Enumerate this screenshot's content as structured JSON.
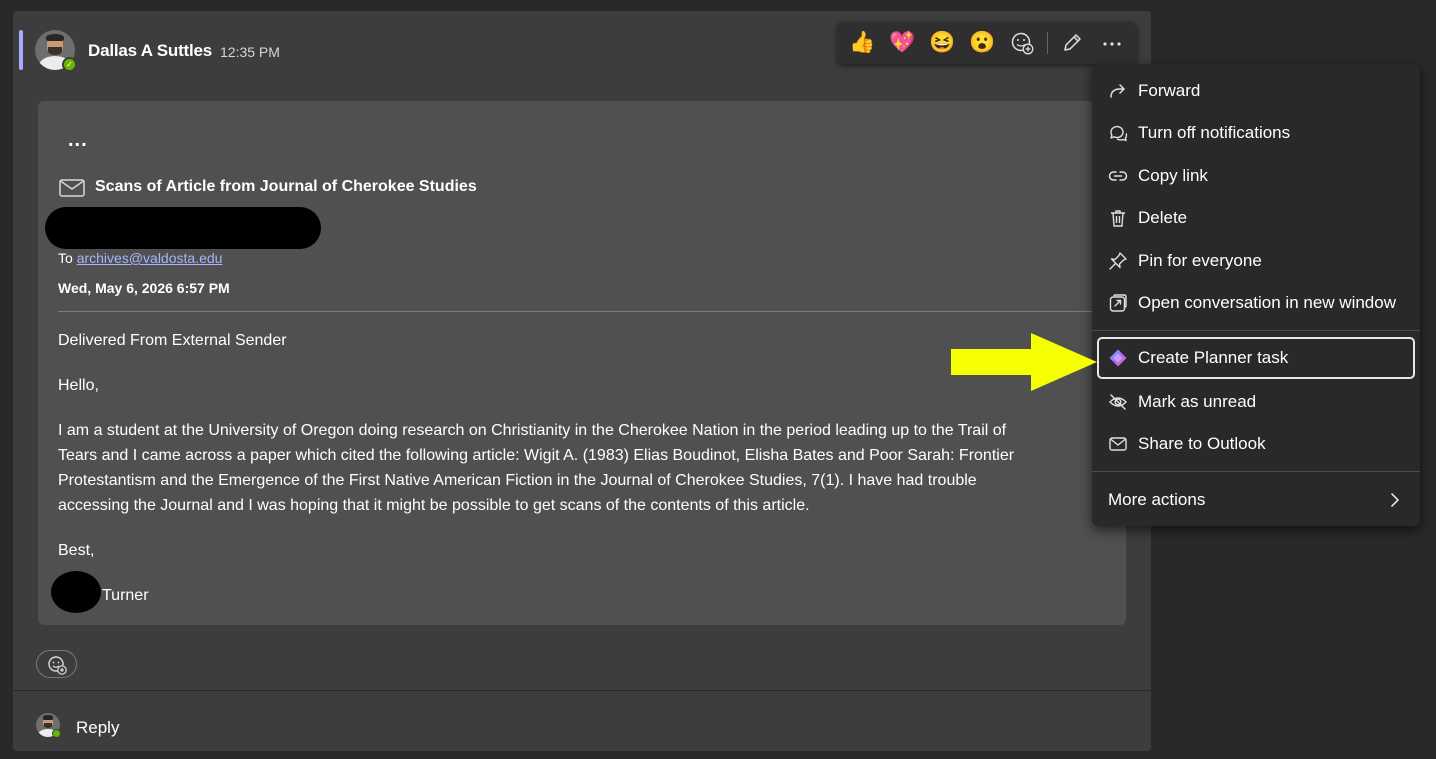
{
  "message": {
    "sender": "Dallas A Suttles",
    "time": "12:35 PM"
  },
  "reactions": [
    "thumbs-up-icon",
    "heart-icon",
    "laugh-icon",
    "surprised-icon",
    "add-reaction-icon"
  ],
  "email": {
    "more_label": "...",
    "subject": "Scans of Article from Journal of Cherokee Studies",
    "to_label": "To",
    "to_address": "archives@valdosta.edu",
    "date": "Wed, May 6, 2026 6:57 PM",
    "external_notice": "Delivered From External Sender",
    "greeting": "Hello,",
    "body_lines": [
      "I am a student at the University of Oregon doing research on Christianity in the Cherokee Nation in the period leading up to the Trail of",
      "Tears and I came across a paper which cited the following article: Wigit A. (1983) Elias Boudinot, Elisha Bates and Poor Sarah: Frontier",
      "Protestantism and the Emergence of the First Native American Fiction in the Journal of Cherokee Studies, 7(1). I have had trouble",
      "accessing the Journal and I was hoping that it might be possible to get scans of the contents of this article."
    ],
    "closing": "Best,",
    "signature": "Turner"
  },
  "reply_label": "Reply",
  "context_menu": {
    "items": [
      {
        "label": "Forward",
        "icon": "forward-icon"
      },
      {
        "label": "Turn off notifications",
        "icon": "chat-bubbles-icon"
      },
      {
        "label": "Copy link",
        "icon": "link-icon"
      },
      {
        "label": "Delete",
        "icon": "trash-icon"
      },
      {
        "label": "Pin for everyone",
        "icon": "pin-icon"
      },
      {
        "label": "Open conversation in new window",
        "icon": "pop-out-icon"
      },
      {
        "label": "Create Planner task",
        "icon": "planner-icon"
      },
      {
        "label": "Mark as unread",
        "icon": "eye-off-icon"
      },
      {
        "label": "Share to Outlook",
        "icon": "mail-icon"
      }
    ],
    "more_actions": "More actions"
  },
  "colors": {
    "accent": "#a9a8ff",
    "annotation_arrow": "#f5ff00",
    "presence": "#6bb700",
    "link": "#a5b5ff"
  }
}
